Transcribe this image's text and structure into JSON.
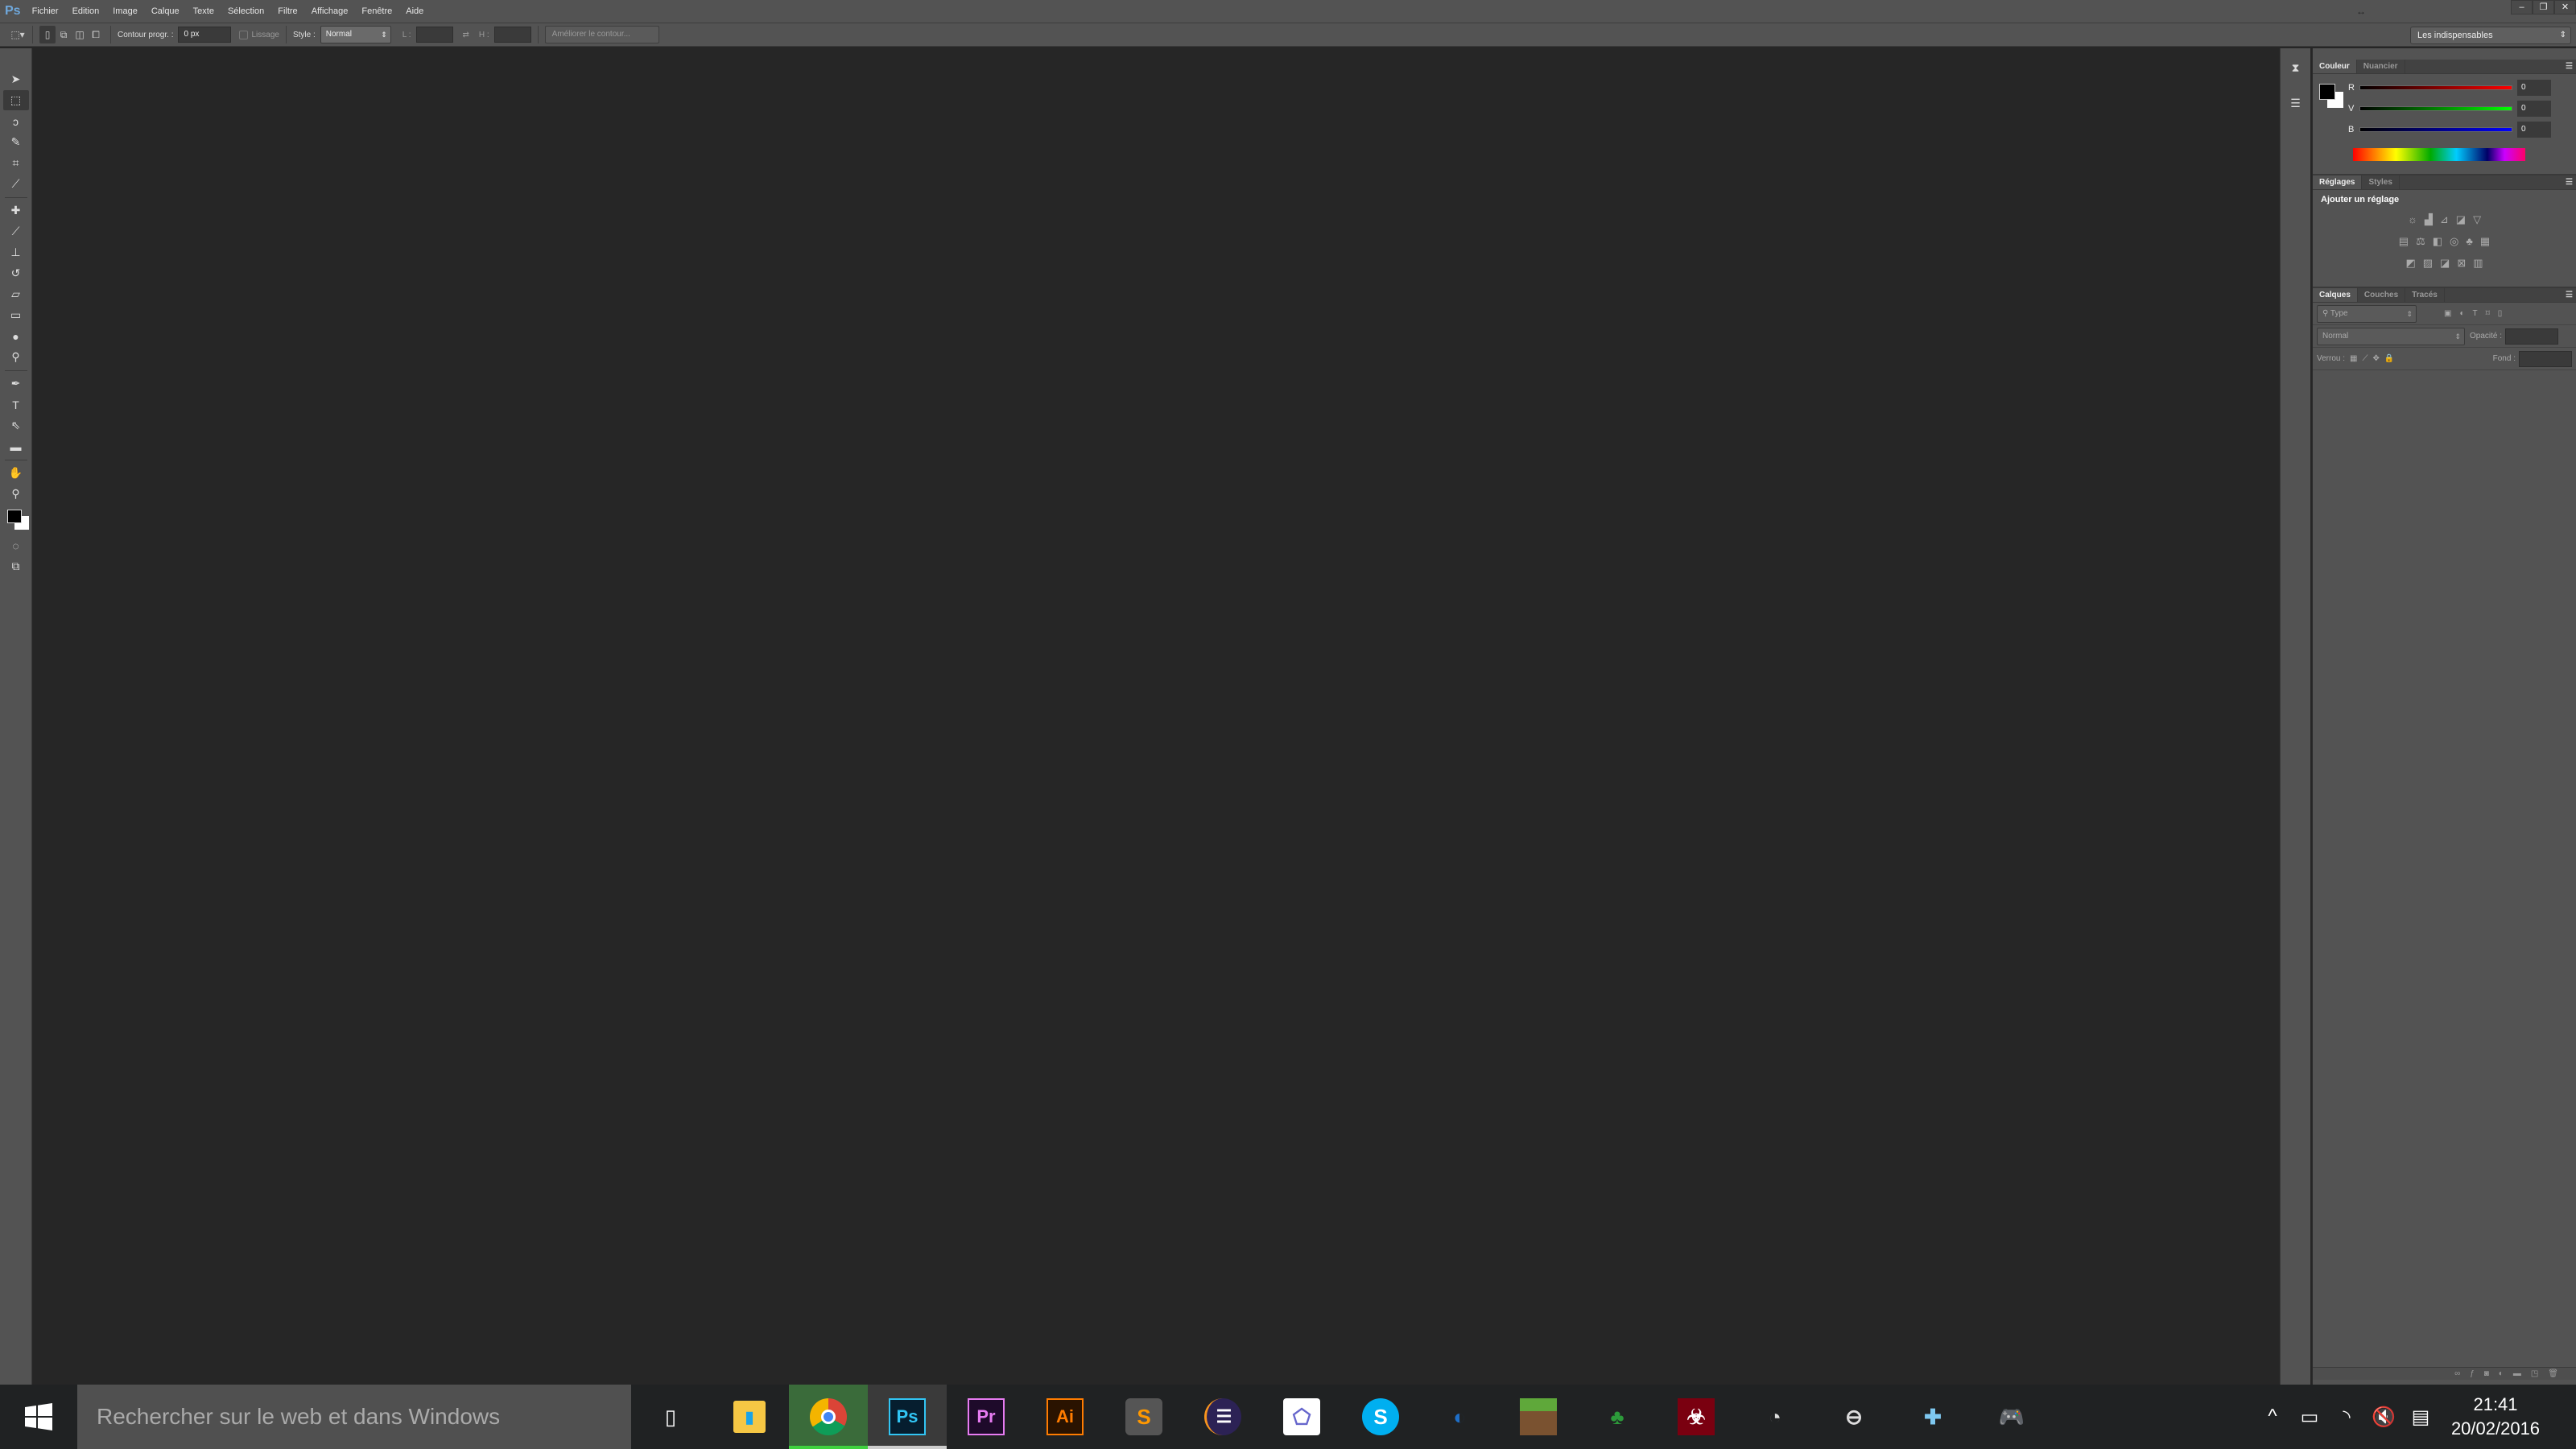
{
  "app": {
    "logo": "Ps"
  },
  "menu": [
    "Fichier",
    "Edition",
    "Image",
    "Calque",
    "Texte",
    "Sélection",
    "Filtre",
    "Affichage",
    "Fenêtre",
    "Aide"
  ],
  "window_controls": {
    "minimize": "–",
    "restore": "❐",
    "close": "✕"
  },
  "options": {
    "feather_label": "Contour progr. :",
    "feather_value": "0 px",
    "antialias_label": "Lissage",
    "style_label": "Style :",
    "style_value": "Normal",
    "width_label": "L :",
    "height_label": "H :",
    "refine_button": "Améliorer le contour...",
    "workspace": "Les indispensables"
  },
  "tools": [
    "move-tool",
    "rectangular-marquee-tool",
    "lasso-tool",
    "quick-selection-tool",
    "crop-tool",
    "eyedropper-tool",
    "spot-healing-tool",
    "brush-tool",
    "clone-stamp-tool",
    "history-brush-tool",
    "eraser-tool",
    "gradient-tool",
    "blur-tool",
    "dodge-tool",
    "pen-tool",
    "type-tool",
    "path-selection-tool",
    "rectangle-tool",
    "hand-tool",
    "zoom-tool"
  ],
  "colors": {
    "foreground": "#000000",
    "background": "#ffffff"
  },
  "color_panel": {
    "tabs": [
      "Couleur",
      "Nuancier"
    ],
    "channels": [
      {
        "label": "R",
        "value": "0",
        "color": "#ff0000"
      },
      {
        "label": "V",
        "value": "0",
        "color": "#00ff00"
      },
      {
        "label": "B",
        "value": "0",
        "color": "#0000ff"
      }
    ]
  },
  "adjust_panel": {
    "tabs": [
      "Réglages",
      "Styles"
    ],
    "heading": "Ajouter un réglage"
  },
  "layers_panel": {
    "tabs": [
      "Calques",
      "Couches",
      "Tracés"
    ],
    "filter": "Type",
    "blend_mode": "Normal",
    "opacity_label": "Opacité :",
    "lock_label": "Verrou :",
    "fill_label": "Fond :"
  },
  "taskbar": {
    "search_placeholder": "Rechercher sur le web et dans Windows",
    "apps": [
      {
        "name": "task-view",
        "label": "▯"
      },
      {
        "name": "file-explorer",
        "label": "📁"
      },
      {
        "name": "chrome",
        "label": "◉"
      },
      {
        "name": "photoshop",
        "label": "Ps"
      },
      {
        "name": "premiere",
        "label": "Pr"
      },
      {
        "name": "illustrator",
        "label": "Ai"
      },
      {
        "name": "sublime-text",
        "label": "S"
      },
      {
        "name": "eclipse",
        "label": "☰"
      },
      {
        "name": "geogebra",
        "label": "⬠"
      },
      {
        "name": "skype",
        "label": "S"
      },
      {
        "name": "phone-companion",
        "label": "◐"
      },
      {
        "name": "minecraft",
        "label": "■"
      },
      {
        "name": "terraria",
        "label": "♣"
      },
      {
        "name": "plague-inc",
        "label": "☣"
      },
      {
        "name": "steam-like",
        "label": "◔"
      },
      {
        "name": "pokeball-app",
        "label": "⊖"
      },
      {
        "name": "ppsspp",
        "label": "✚"
      },
      {
        "name": "gamepad-app",
        "label": "🎮"
      }
    ],
    "clock_time": "21:41",
    "clock_date": "20/02/2016"
  }
}
